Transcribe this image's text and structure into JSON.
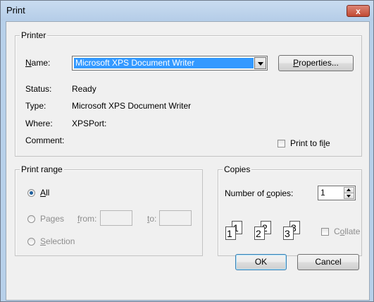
{
  "window": {
    "title": "Print",
    "close_glyph": "x"
  },
  "printer": {
    "group_label": "Printer",
    "name_label": "Name:",
    "name_value": "Microsoft XPS Document Writer",
    "properties_label": "Properties...",
    "status_label": "Status:",
    "status_value": "Ready",
    "type_label": "Type:",
    "type_value": "Microsoft XPS Document Writer",
    "where_label": "Where:",
    "where_value": "XPSPort:",
    "comment_label": "Comment:",
    "print_to_file_label": "Print to file",
    "print_to_file_checked": false
  },
  "print_range": {
    "group_label": "Print range",
    "all_label": "All",
    "pages_label": "Pages",
    "from_label": "from:",
    "to_label": "to:",
    "from_value": "",
    "to_value": "",
    "selection_label": "Selection",
    "selected": "All"
  },
  "copies": {
    "group_label": "Copies",
    "number_label": "Number of copies:",
    "number_value": "1",
    "collate_label": "Collate",
    "collate_checked": false,
    "page_numbers": [
      "1",
      "1",
      "2",
      "2",
      "3",
      "3"
    ]
  },
  "buttons": {
    "ok_label": "OK",
    "cancel_label": "Cancel"
  }
}
